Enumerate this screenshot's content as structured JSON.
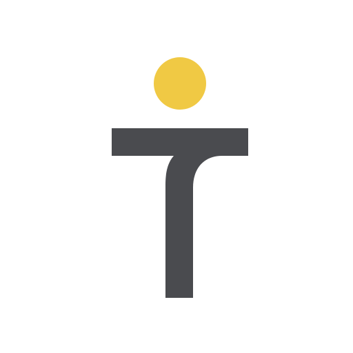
{
  "app_icon": {
    "icon_name": "t-letter-logo-icon",
    "colors": {
      "background": "#ffffff",
      "letter": "#4a4b4f",
      "dot": "#f0c944"
    }
  }
}
